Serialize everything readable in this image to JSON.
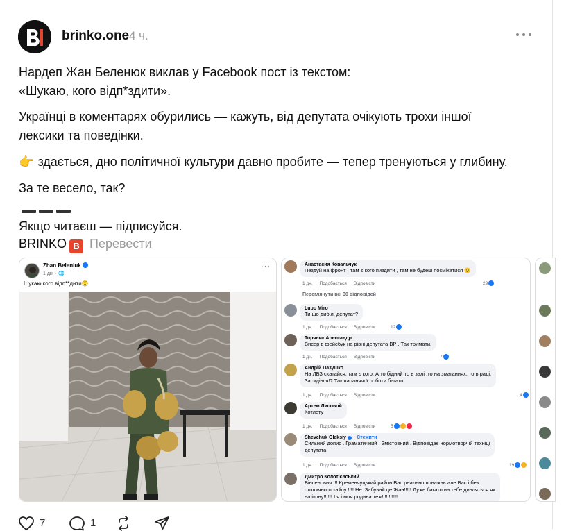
{
  "post": {
    "author": "brinko.one",
    "time": "4 ч.",
    "lines": [
      "Нардеп Жан Беленюк виклав у Facebook пост із текстом:",
      "«Шукаю, кого відп*здити».",
      "Українці в коментарях обурились — кажуть, від депутата очікують трохи іншої",
      "лексики та поведінки.",
      "здається, дно політичної культури давно пробите — тепер тренуються у глибину.",
      "За те весело, так?",
      "Якщо читаєш — підписуйся."
    ],
    "pointing_emoji": "👉",
    "brand": "BRINKO",
    "brand_badge": "B",
    "translate_label": "Перевести"
  },
  "fb_post": {
    "name": "Zhan Beleniuk",
    "date": "1 дн. · 🌐",
    "text": "Шукаю кого відп**дити😤"
  },
  "comments": {
    "view_all": "Переглянути всі 30 відповідей",
    "follow_label": "· Стежити",
    "items": [
      {
        "name": "Анастасия Ковальчук",
        "lines": [
          "Пездуй на фронт , там є кого пиздити , там не будеш посміхатися 😉"
        ],
        "time": "1 дн.",
        "like": "Подобається",
        "reply": "Відповісти",
        "count": "29"
      },
      {
        "name": "Lubo Miro",
        "lines": [
          "Ти шо дибіл, депутат?"
        ],
        "time": "1 дн.",
        "like": "Подобається",
        "reply": "Відповісти",
        "count": "12"
      },
      {
        "name": "Торяник Александр",
        "lines": [
          "Висер в фейсбук на рівні депутата ВР . Так тримати."
        ],
        "time": "1 дн.",
        "like": "Подобається",
        "reply": "Відповісти",
        "count": "7"
      },
      {
        "name": "Андрій Пазушко",
        "lines": [
          "На ЛБЗ скатайся, там є кого. А то бідний то в залі ,то на змаганнях, то в раді.",
          "Засидівся!? Так пацанячої роботи багато."
        ],
        "time": "1 дн.",
        "like": "Подобається",
        "reply": "Відповісти",
        "count": "4"
      },
      {
        "name": "Артем Лисовой",
        "lines": [
          "Котлету"
        ],
        "time": "1 дн.",
        "like": "Подобається",
        "reply": "Відповісти",
        "count": "5"
      },
      {
        "name": "Shevchuk Oleksiy",
        "lines": [
          "Сильний допис . Граматичний . Змістовний . Відповідає нормотворчій техніці",
          "депутата"
        ],
        "time": "1 дн.",
        "like": "Подобається",
        "reply": "Відповісти",
        "count": "19"
      },
      {
        "name": "Дмитро Колотієвський",
        "lines": [
          "Вінсенович !!! Кременчуцький район Вас реально поважає але Вас і без",
          "столичного хайпу !!!! Не. Забувай це Жан!!!!! Дуже багато на тебе дивляться як",
          "на ікону!!!!!! І я і моя родина теж!!!!!!!!!!!"
        ],
        "time": "",
        "like": "",
        "reply": "",
        "count": ""
      }
    ]
  },
  "actions": {
    "likes": "7",
    "replies": "1"
  },
  "colors": {
    "accent_red": "#e8442c",
    "fb_blue": "#1877f2"
  }
}
